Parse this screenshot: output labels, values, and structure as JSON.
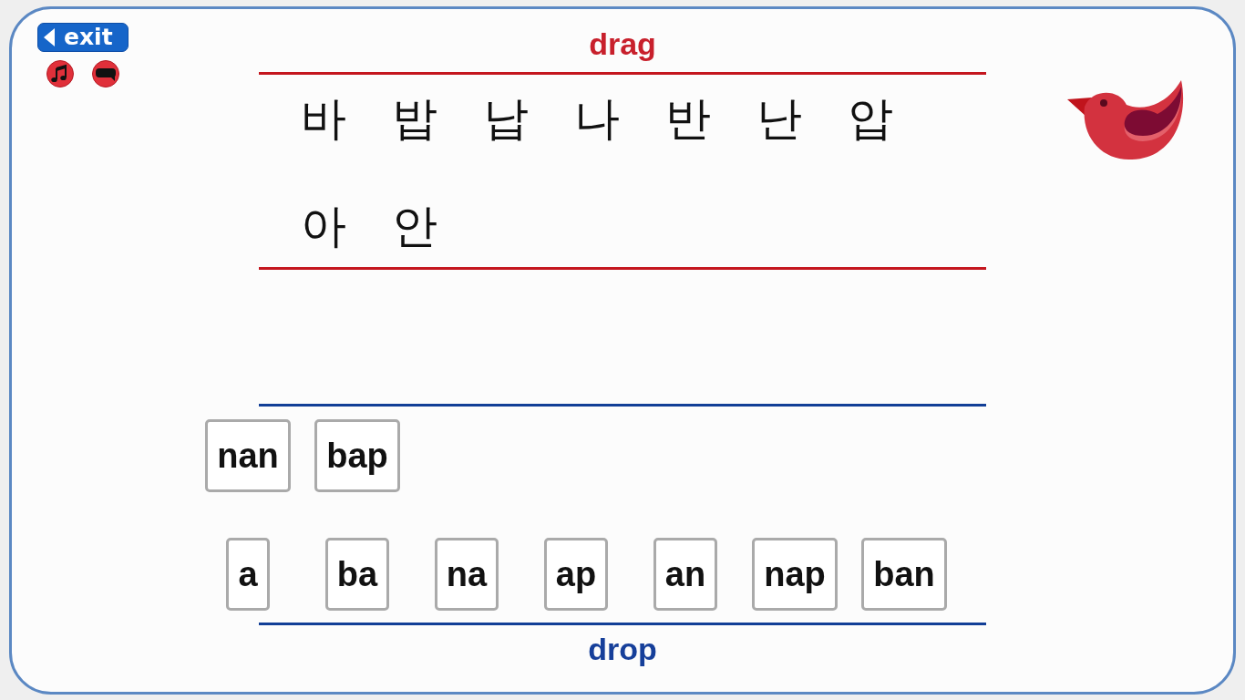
{
  "exit_button": {
    "label": "exit"
  },
  "drag_area": {
    "label": "drag",
    "syllables": [
      "바",
      "밥",
      "납",
      "나",
      "반",
      "난",
      "압",
      "아",
      "안"
    ]
  },
  "drop_area": {
    "label": "drop",
    "tile_rows": [
      [
        "nan",
        "bap"
      ],
      [
        "a",
        "ba",
        "na",
        "ap",
        "an",
        "nap",
        "ban"
      ]
    ]
  }
}
